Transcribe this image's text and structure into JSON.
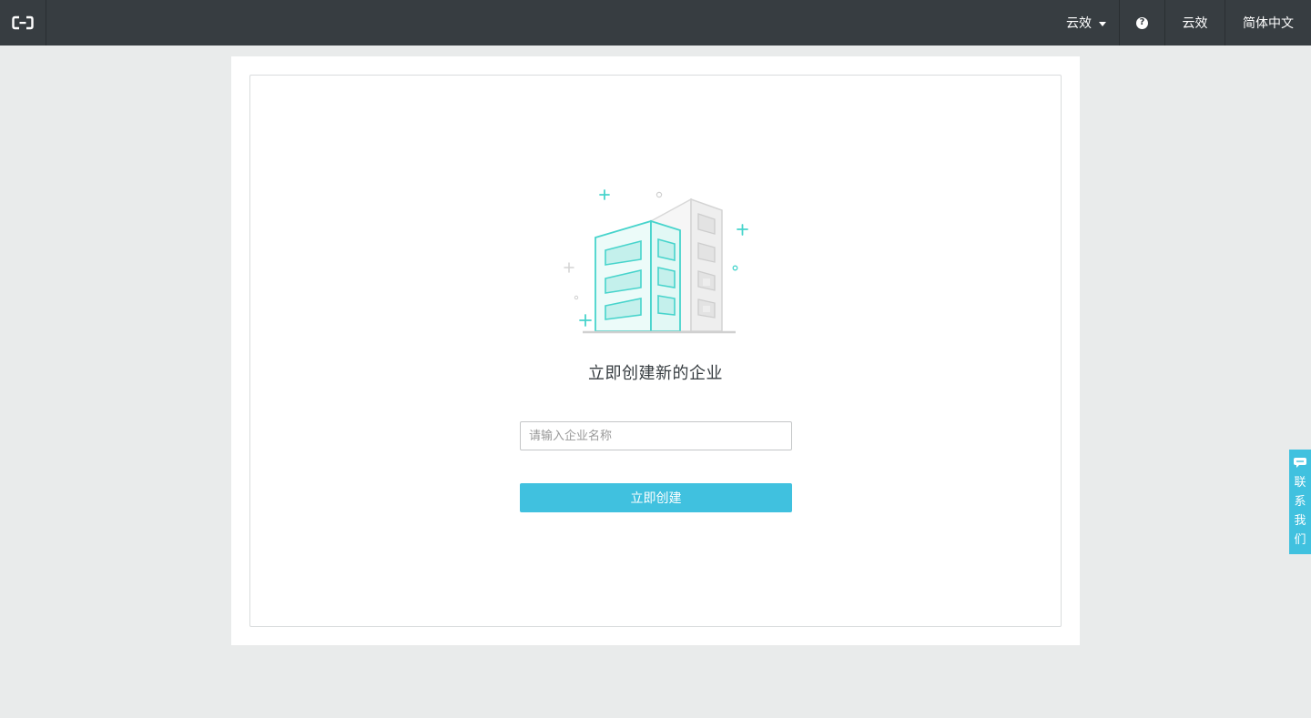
{
  "header": {
    "logo_icon": "aliyun-logo-icon",
    "product_menu_label": "云效",
    "help_icon": "question-circle-icon",
    "product_link": "云效",
    "language": "简体中文"
  },
  "main": {
    "illustration_icon": "building-icon",
    "headline": "立即创建新的企业",
    "name_input": {
      "value": "",
      "placeholder": "请输入企业名称"
    },
    "create_button_label": "立即创建"
  },
  "contact_tab": {
    "icon": "chat-bubble-icon",
    "label": "联系我们"
  },
  "colors": {
    "topbar": "#373d41",
    "background": "#e9ebeb",
    "accent": "#40c1df",
    "illustration_teal": "#47d4cc"
  }
}
